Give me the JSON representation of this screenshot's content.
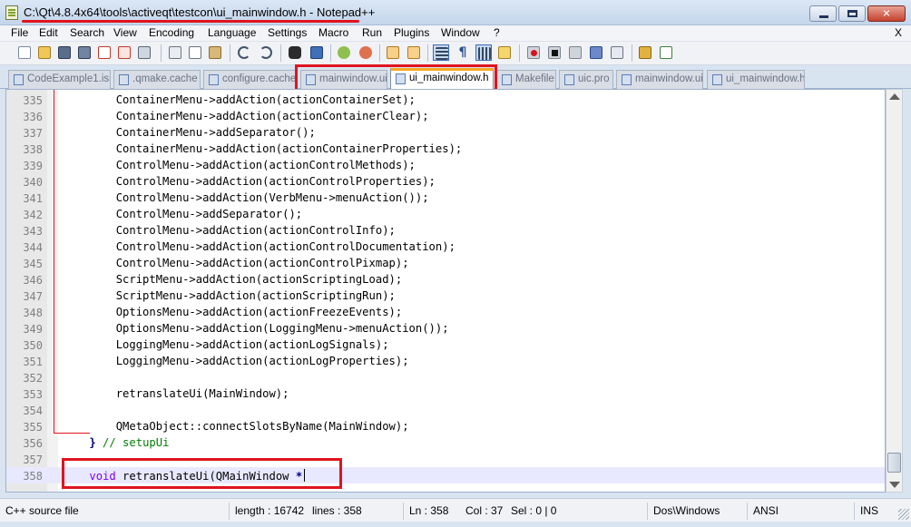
{
  "window": {
    "title": "C:\\Qt\\4.8.4x64\\tools\\activeqt\\testcon\\ui_mainwindow.h - Notepad++",
    "minimize_label": "minimize",
    "close_glyph": "✕"
  },
  "menu": {
    "items": [
      "File",
      "Edit",
      "Search",
      "View",
      "Encoding",
      "Language",
      "Settings",
      "Macro",
      "Run",
      "Plugins",
      "Window",
      "?"
    ],
    "close_label": "X"
  },
  "toolbar": {
    "icons": [
      "new-file-icon",
      "open-file-icon",
      "save-icon",
      "save-all-icon",
      "close-icon",
      "close-all-icon",
      "print-icon",
      "cut-icon",
      "copy-icon",
      "paste-icon",
      "undo-icon",
      "redo-icon",
      "find-icon",
      "replace-icon",
      "zoom-in-icon",
      "zoom-out-icon",
      "sync-vertical-icon",
      "sync-horizontal-icon",
      "word-wrap-icon",
      "show-all-chars-icon",
      "indent-guide-icon",
      "doc-map-icon",
      "record-macro-icon",
      "stop-record-icon",
      "play-macro-icon",
      "run-macro-multiple-icon",
      "save-macro-icon",
      "plugin-icon",
      "spellcheck-icon"
    ]
  },
  "tabs": [
    {
      "label": "CodeExample1.iss",
      "active": false
    },
    {
      "label": ".qmake.cache",
      "active": false
    },
    {
      "label": "configure.cache",
      "active": false
    },
    {
      "label": "mainwindow.ui",
      "active": false
    },
    {
      "label": "ui_mainwindow.h",
      "active": true
    },
    {
      "label": "Makefile",
      "active": false
    },
    {
      "label": "uic.pro",
      "active": false
    },
    {
      "label": "mainwindow.ui",
      "active": false
    },
    {
      "label": "ui_mainwindow.h",
      "active": false
    }
  ],
  "editor": {
    "lines": [
      {
        "num": "335",
        "code": "        ContainerMenu->addAction(actionContainerSet);"
      },
      {
        "num": "336",
        "code": "        ContainerMenu->addAction(actionContainerClear);"
      },
      {
        "num": "337",
        "code": "        ContainerMenu->addSeparator();"
      },
      {
        "num": "338",
        "code": "        ContainerMenu->addAction(actionContainerProperties);"
      },
      {
        "num": "339",
        "code": "        ControlMenu->addAction(actionControlMethods);"
      },
      {
        "num": "340",
        "code": "        ControlMenu->addAction(actionControlProperties);"
      },
      {
        "num": "341",
        "code": "        ControlMenu->addAction(VerbMenu->menuAction());"
      },
      {
        "num": "342",
        "code": "        ControlMenu->addSeparator();"
      },
      {
        "num": "343",
        "code": "        ControlMenu->addAction(actionControlInfo);"
      },
      {
        "num": "344",
        "code": "        ControlMenu->addAction(actionControlDocumentation);"
      },
      {
        "num": "345",
        "code": "        ControlMenu->addAction(actionControlPixmap);"
      },
      {
        "num": "346",
        "code": "        ScriptMenu->addAction(actionScriptingLoad);"
      },
      {
        "num": "347",
        "code": "        ScriptMenu->addAction(actionScriptingRun);"
      },
      {
        "num": "348",
        "code": "        OptionsMenu->addAction(actionFreezeEvents);"
      },
      {
        "num": "349",
        "code": "        OptionsMenu->addAction(LoggingMenu->menuAction());"
      },
      {
        "num": "350",
        "code": "        LoggingMenu->addAction(actionLogSignals);"
      },
      {
        "num": "351",
        "code": "        LoggingMenu->addAction(actionLogProperties);"
      },
      {
        "num": "352",
        "code": ""
      },
      {
        "num": "353",
        "code": "        retranslateUi(MainWindow);"
      },
      {
        "num": "354",
        "code": ""
      },
      {
        "num": "355",
        "code": "        QMetaObject::connectSlotsByName(MainWindow);"
      },
      {
        "num": "356",
        "code_pre": "    ",
        "code_op": "}",
        "code_cm": " // setupUi"
      },
      {
        "num": "357",
        "code": ""
      },
      {
        "num": "358",
        "code_pre": "    ",
        "code_kw": "void",
        "code_rest": " retranslateUi(QMainWindow ",
        "code_op": "*"
      }
    ]
  },
  "status": {
    "file_type": "C++ source file",
    "length": "length : 16742",
    "lines": "lines : 358",
    "ln": "Ln : 358",
    "col": "Col : 37",
    "sel": "Sel : 0 | 0",
    "eol": "Dos\\Windows",
    "encoding": "ANSI",
    "mode": "INS"
  },
  "colors": {
    "annotation_red": "#e0141e",
    "active_tab_accent": "#f5a623",
    "keyword": "#8000ff",
    "comment": "#008000"
  }
}
